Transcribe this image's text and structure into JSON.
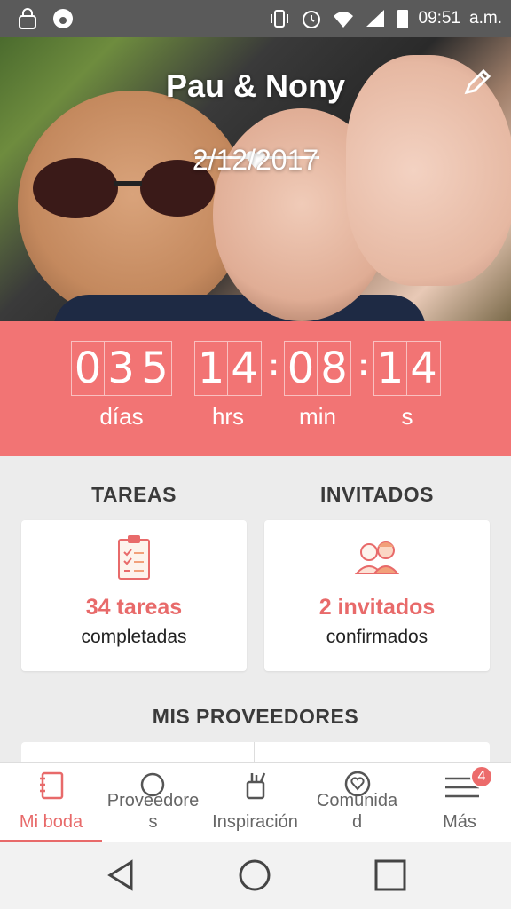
{
  "status_bar": {
    "time": "09:51",
    "ampm": "a.m.",
    "left_icons": [
      "lock-icon",
      "notification-icon"
    ],
    "right_icons": [
      "vibrate-icon",
      "alarm-icon",
      "wifi-icon",
      "signal-icon",
      "battery-icon"
    ]
  },
  "hero": {
    "couple_names": "Pau & Nony",
    "wedding_date": "2/12/2017",
    "edit_icon": "pencil-icon"
  },
  "countdown": {
    "days_digits": [
      "0",
      "3",
      "5"
    ],
    "hours_digits": [
      "1",
      "4"
    ],
    "minutes_digits": [
      "0",
      "8"
    ],
    "seconds_digits": [
      "1",
      "4"
    ],
    "days_label": "días",
    "hours_label": "hrs",
    "minutes_label": "min",
    "seconds_label": "s",
    "colon": ":"
  },
  "tasks": {
    "title": "TAREAS",
    "count_text": "34 tareas",
    "status_text": "completadas",
    "icon": "clipboard-icon"
  },
  "guests": {
    "title": "INVITADOS",
    "count_text": "2 invitados",
    "status_text": "confirmados",
    "icon": "guests-icon"
  },
  "providers": {
    "title": "MIS PROVEEDORES"
  },
  "bottom_nav": {
    "items": [
      {
        "label": "Mi boda",
        "icon": "notebook-icon"
      },
      {
        "label": "Proveedore",
        "label2": "s",
        "icon": "search-icon"
      },
      {
        "label": "Inspiración",
        "icon": "inspiration-icon"
      },
      {
        "label": "Comunida",
        "label2": "d",
        "icon": "heart-chat-icon"
      },
      {
        "label": "Más",
        "icon": "menu-icon",
        "badge": "4"
      }
    ]
  },
  "colors": {
    "accent": "#f27474",
    "accent_text": "#e86a6a"
  }
}
